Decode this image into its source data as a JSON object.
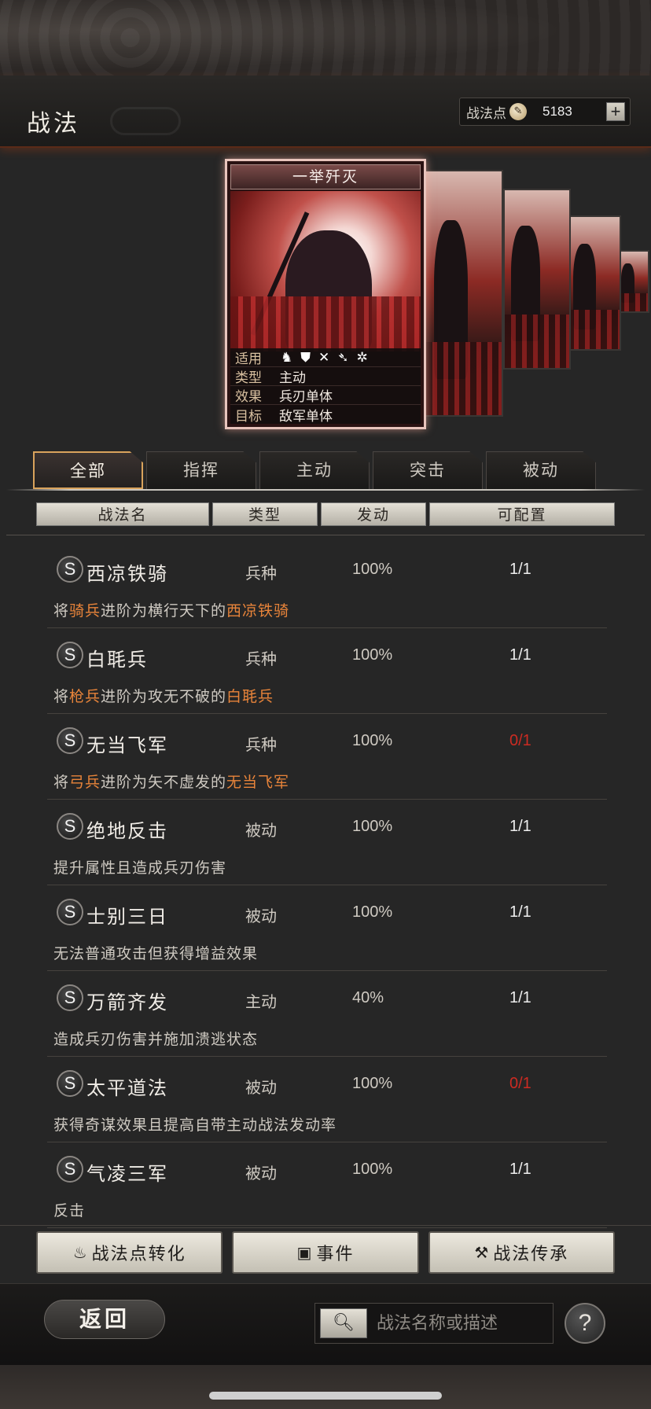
{
  "header": {
    "title": "战法",
    "points_label": "战法点",
    "points_value": "5183",
    "plus": "+"
  },
  "featured_card": {
    "name": "一举歼灭",
    "info": [
      {
        "key": "适用",
        "value": ""
      },
      {
        "key": "类型",
        "value": "主动"
      },
      {
        "key": "效果",
        "value": "兵刃单体"
      },
      {
        "key": "目标",
        "value": "敌军单体"
      }
    ],
    "unit_icons": [
      "cavalry-icon",
      "shield-icon",
      "archer-icon",
      "spear-icon",
      "siege-icon"
    ]
  },
  "tabs": [
    {
      "label": "全部",
      "active": true
    },
    {
      "label": "指挥",
      "active": false
    },
    {
      "label": "主动",
      "active": false
    },
    {
      "label": "突击",
      "active": false
    },
    {
      "label": "被动",
      "active": false
    }
  ],
  "columns": [
    "战法名",
    "类型",
    "发动",
    "可配置"
  ],
  "rows": [
    {
      "badge": "S",
      "name": "西凉铁骑",
      "type": "兵种",
      "rate": "100%",
      "slots": "1/1",
      "desc_parts": [
        "将",
        "骑兵",
        "进阶为横行天下的",
        "西凉铁骑"
      ]
    },
    {
      "badge": "S",
      "name": "白毦兵",
      "type": "兵种",
      "rate": "100%",
      "slots": "1/1",
      "desc_parts": [
        "将",
        "枪兵",
        "进阶为攻无不破的",
        "白毦兵"
      ]
    },
    {
      "badge": "S",
      "name": "无当飞军",
      "type": "兵种",
      "rate": "100%",
      "slots": "0/1",
      "desc_parts": [
        "将",
        "弓兵",
        "进阶为矢不虚发的",
        "无当飞军"
      ]
    },
    {
      "badge": "S",
      "name": "绝地反击",
      "type": "被动",
      "rate": "100%",
      "slots": "1/1",
      "desc_parts": [
        "提升属性且造成兵刃伤害"
      ]
    },
    {
      "badge": "S",
      "name": "士别三日",
      "type": "被动",
      "rate": "100%",
      "slots": "1/1",
      "desc_parts": [
        "无法普通攻击但获得增益效果"
      ]
    },
    {
      "badge": "S",
      "name": "万箭齐发",
      "type": "主动",
      "rate": "40%",
      "slots": "1/1",
      "desc_parts": [
        "造成兵刃伤害并施加溃逃状态"
      ]
    },
    {
      "badge": "S",
      "name": "太平道法",
      "type": "被动",
      "rate": "100%",
      "slots": "0/1",
      "desc_parts": [
        "获得奇谋效果且提高自带主动战法发动率"
      ]
    },
    {
      "badge": "S",
      "name": "气凌三军",
      "type": "被动",
      "rate": "100%",
      "slots": "1/1",
      "desc_parts": [
        "反击"
      ]
    }
  ],
  "actions": {
    "convert": "战法点转化",
    "events": "事件",
    "inherit": "战法传承"
  },
  "footer": {
    "back": "返回",
    "search_placeholder": "战法名称或描述",
    "help": "?"
  },
  "colors": {
    "highlight": "#e8843a",
    "unavailable": "#cc2b22",
    "active_tab_border": "#d9a35c"
  }
}
